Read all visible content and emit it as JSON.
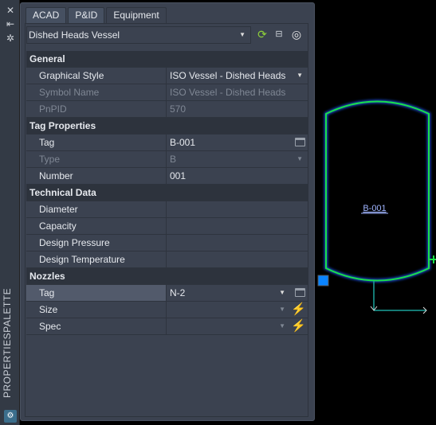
{
  "strip": {
    "title": "PROPERTIESPALETTE",
    "icons": [
      "close-icon",
      "auto-hide-icon",
      "settings-icon"
    ]
  },
  "tabs": [
    {
      "label": "ACAD"
    },
    {
      "label": "P&ID"
    },
    {
      "label": "Equipment",
      "active": true
    }
  ],
  "selector": {
    "value": "Dished Heads Vessel"
  },
  "toolbar": [
    "refresh-icon",
    "toggle-pickadd-icon",
    "select-objects-icon"
  ],
  "sections": [
    {
      "title": "General",
      "rows": [
        {
          "label": "Graphical Style",
          "value": "ISO Vessel - Dished Heads",
          "dropdown": true
        },
        {
          "label": "Symbol Name",
          "value": "ISO Vessel - Dished Heads",
          "disabled": true
        },
        {
          "label": "PnPID",
          "value": "570",
          "disabled": true
        }
      ]
    },
    {
      "title": "Tag Properties",
      "rows": [
        {
          "label": "Tag",
          "value": "B-001",
          "button": true
        },
        {
          "label": "Type",
          "value": "B",
          "disabled": true,
          "dropdown": true
        },
        {
          "label": "Number",
          "value": "001"
        }
      ]
    },
    {
      "title": "Technical Data",
      "rows": [
        {
          "label": "Diameter",
          "value": ""
        },
        {
          "label": "Capacity",
          "value": ""
        },
        {
          "label": "Design Pressure",
          "value": ""
        },
        {
          "label": "Design Temperature",
          "value": ""
        }
      ]
    },
    {
      "title": "Nozzles",
      "rows": [
        {
          "label": "Tag",
          "value": "N-2",
          "dropdown": true,
          "button": true,
          "selected": true
        },
        {
          "label": "Size",
          "value": "",
          "dropdown": true,
          "bolt": true
        },
        {
          "label": "Spec",
          "value": "",
          "dropdown": true,
          "bolt": true
        }
      ]
    }
  ],
  "drawing": {
    "vessel_tag": "B-001",
    "colors": {
      "outline": "#19e04a",
      "glow": "#1a4fd8",
      "tag": "#9fb4ff",
      "line": "#1aa39a",
      "grip": "#0a84ff"
    }
  }
}
